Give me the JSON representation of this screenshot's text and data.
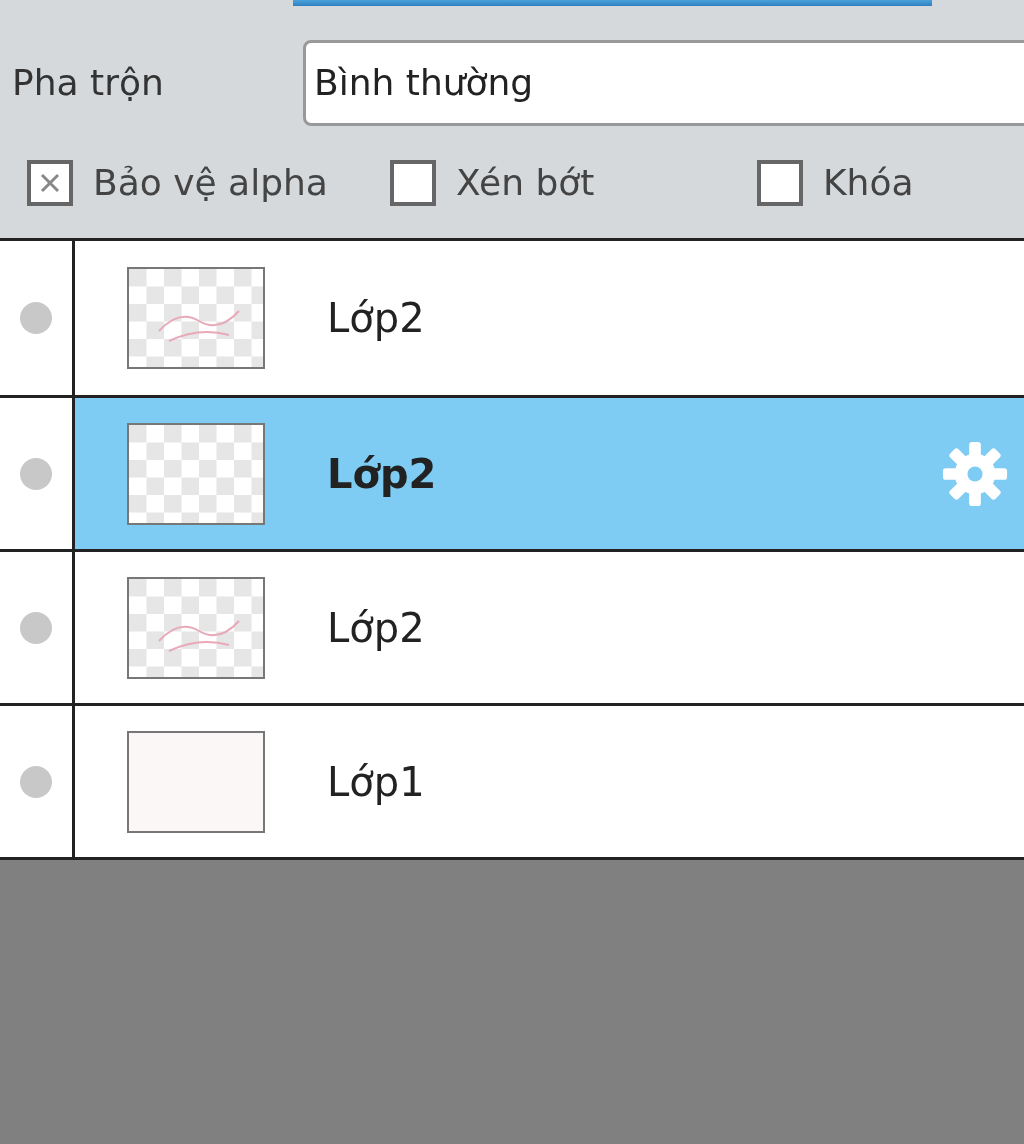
{
  "blend": {
    "label": "Pha trộn",
    "value": "Bình thường"
  },
  "options": [
    {
      "label": "Bảo vệ alpha",
      "checked": true
    },
    {
      "label": "Xén bớt",
      "checked": false
    },
    {
      "label": "Khóa",
      "checked": false
    }
  ],
  "layers": [
    {
      "name": "Lớp2",
      "selected": false,
      "kind": "sketch"
    },
    {
      "name": "Lớp2",
      "selected": true,
      "kind": "empty"
    },
    {
      "name": "Lớp2",
      "selected": false,
      "kind": "sketch"
    },
    {
      "name": "Lớp1",
      "selected": false,
      "kind": "paper"
    }
  ]
}
